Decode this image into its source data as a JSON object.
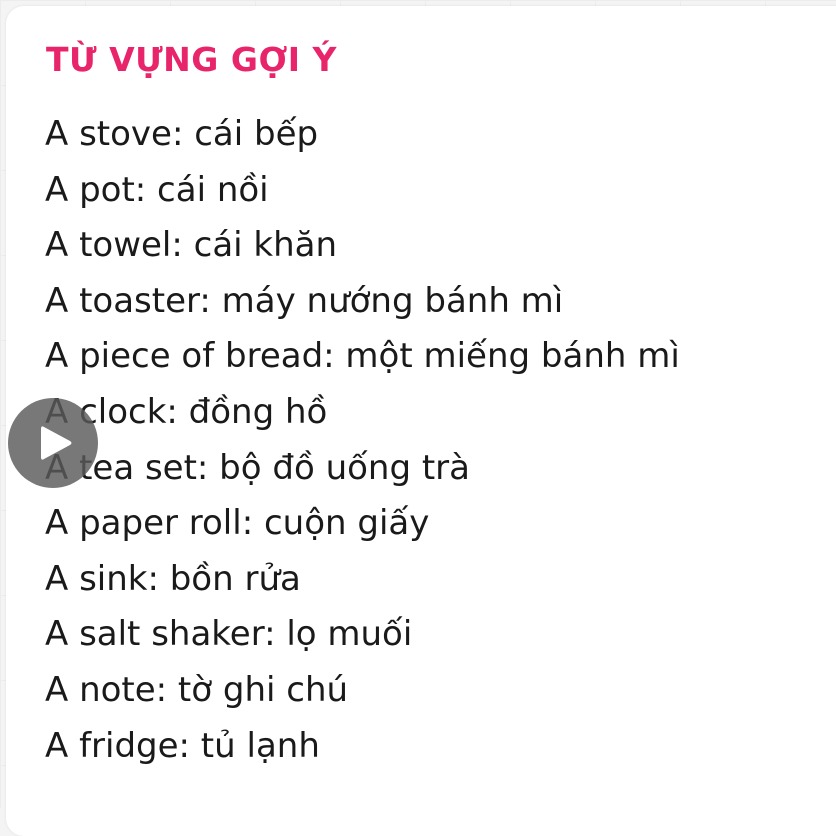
{
  "header": {
    "title": "TỪ VỰNG GỢI Ý"
  },
  "colors": {
    "title": "#e8246a",
    "text": "#1a1a1a",
    "play_button_bg": "#5a5a5a",
    "play_icon": "#ffffff"
  },
  "vocabulary": {
    "items": [
      "A stove: cái bếp",
      "A pot: cái nồi",
      "A towel: cái khăn",
      "A toaster: máy nướng bánh mì",
      "A piece of bread: một miếng bánh mì",
      "A clock: đồng hồ",
      "A tea set: bộ đồ uống trà",
      "A paper roll: cuộn giấy",
      "A sink: bồn rửa",
      "A salt shaker: lọ muối",
      "A note: tờ ghi chú",
      "A fridge: tủ lạnh"
    ]
  },
  "media": {
    "play_icon": "play-icon"
  }
}
